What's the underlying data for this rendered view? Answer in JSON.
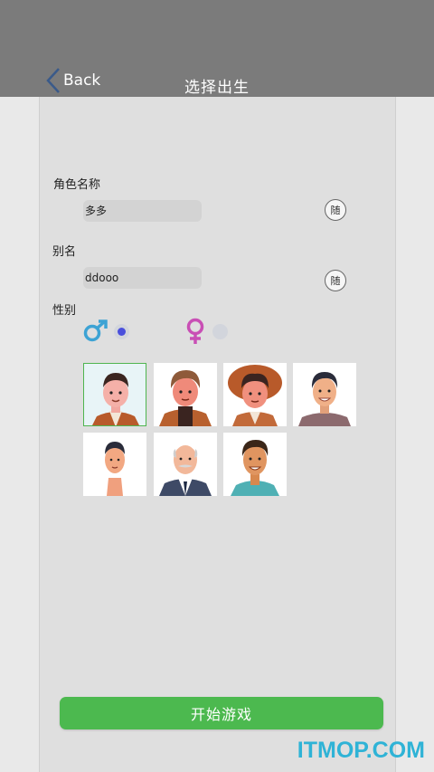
{
  "header": {
    "back_label": "Back",
    "title": "选择出生"
  },
  "form": {
    "name_label": "角色名称",
    "name_value": "多多",
    "alias_label": "别名",
    "alias_value": "ddooo",
    "random_label": "随",
    "gender_label": "性别",
    "gender_selected": "male",
    "colors": {
      "male": "#3da3d4",
      "female": "#c94fb5",
      "radio_on": "#4a4fdc"
    }
  },
  "avatars": [
    {
      "icon": "avatar-man-red-shirt-icon",
      "selected": true
    },
    {
      "icon": "avatar-man-brown-hair-icon",
      "selected": false
    },
    {
      "icon": "avatar-man-hat-icon",
      "selected": false
    },
    {
      "icon": "avatar-man-smiling-icon",
      "selected": false
    },
    {
      "icon": "avatar-man-short-hair-icon",
      "selected": false
    },
    {
      "icon": "avatar-old-man-suit-icon",
      "selected": false
    },
    {
      "icon": "avatar-man-teal-shirt-icon",
      "selected": false
    }
  ],
  "start_button": "开始游戏",
  "watermark": "ITMOP.COM",
  "accent": "#4cb94f"
}
